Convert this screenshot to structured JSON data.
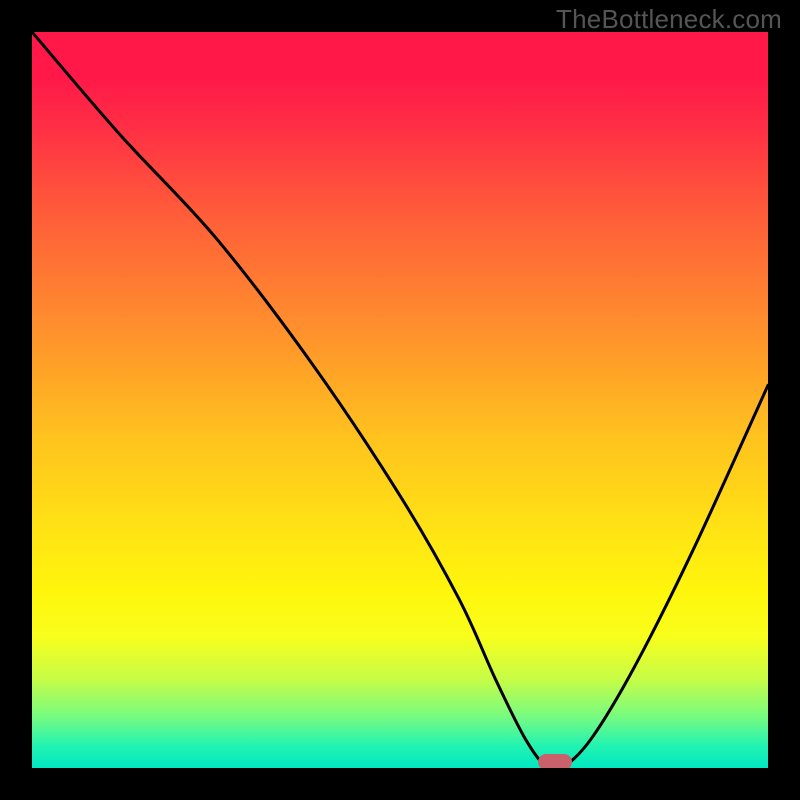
{
  "watermark": "TheBottleneck.com",
  "colors": {
    "frame": "#000000",
    "marker": "#c9616c",
    "curve": "#000000"
  },
  "chart_data": {
    "type": "line",
    "title": "",
    "xlabel": "",
    "ylabel": "",
    "xlim": [
      0,
      100
    ],
    "ylim": [
      0,
      100
    ],
    "series": [
      {
        "name": "bottleneck-curve",
        "x": [
          0,
          12,
          25,
          38,
          50,
          58,
          63,
          67,
          70,
          72,
          76,
          82,
          90,
          100
        ],
        "values": [
          100,
          86,
          72,
          55,
          37,
          23,
          12,
          4,
          0,
          0,
          4,
          14,
          30,
          52
        ]
      }
    ],
    "marker": {
      "x": 71,
      "y": 0
    },
    "gradient_stops": [
      {
        "pos": 0,
        "color": "#ff1848"
      },
      {
        "pos": 6,
        "color": "#ff1848"
      },
      {
        "pos": 13,
        "color": "#ff2f45"
      },
      {
        "pos": 24,
        "color": "#ff5a3a"
      },
      {
        "pos": 40,
        "color": "#ff8f2d"
      },
      {
        "pos": 55,
        "color": "#ffc21e"
      },
      {
        "pos": 68,
        "color": "#ffe414"
      },
      {
        "pos": 76,
        "color": "#fff60c"
      },
      {
        "pos": 82,
        "color": "#f9fe1b"
      },
      {
        "pos": 88,
        "color": "#c6fd47"
      },
      {
        "pos": 93,
        "color": "#77fb80"
      },
      {
        "pos": 97,
        "color": "#22f3b2"
      },
      {
        "pos": 100,
        "color": "#00e7c1"
      }
    ]
  }
}
